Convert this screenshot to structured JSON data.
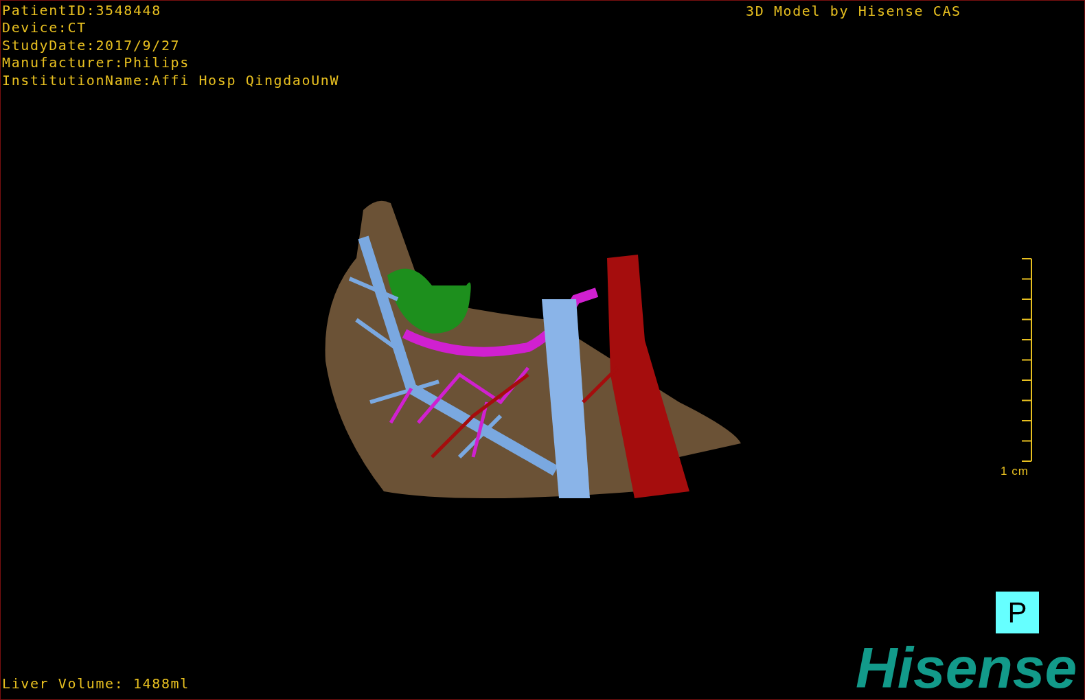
{
  "patient_info": [
    "PatientID:3548448",
    "Device:CT",
    "StudyDate:2017/9/27",
    "Manufacturer:Philips",
    "InstitutionName:Affi Hosp QingdaoUnW"
  ],
  "model_credit": "3D Model by Hisense CAS",
  "scale_bar": {
    "label": "1 cm"
  },
  "orientation_marker": "P",
  "logo": "Hisense",
  "liver_volume": "Liver Volume: 1488ml"
}
